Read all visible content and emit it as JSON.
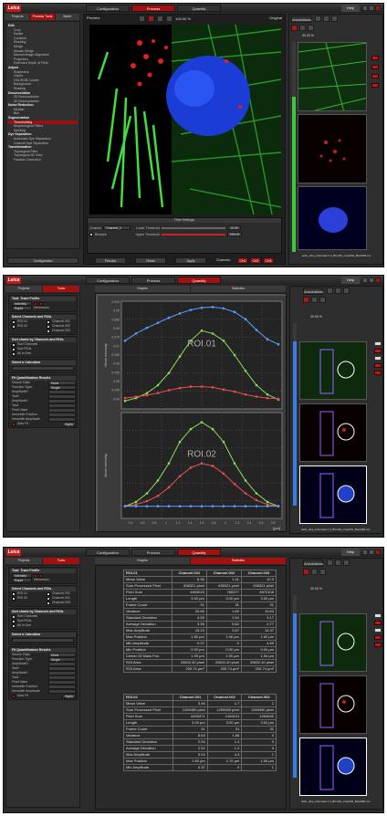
{
  "app": {
    "logo": "Leica",
    "help": "Help"
  },
  "screens": [
    {
      "tabs": [
        "Configuration",
        "Process",
        "Quantify"
      ],
      "active": 1
    },
    {
      "tabs": [
        "Configuration",
        "Process",
        "Quantify"
      ],
      "active": 2
    },
    {
      "tabs": [
        "Configuration",
        "Process",
        "Quantify"
      ],
      "active": 2
    }
  ],
  "s1": {
    "subtabs": [
      "Projects",
      "Process Tools",
      "Batch Deconvolution"
    ],
    "tree": [
      {
        "t": "Edit",
        "h": 1
      },
      {
        "t": "Crop"
      },
      {
        "t": "Rotate"
      },
      {
        "t": "Combine"
      },
      {
        "t": "Resizing"
      },
      {
        "t": "Merge"
      },
      {
        "t": "Mosaic Merge"
      },
      {
        "t": "Manual Image Alignment"
      },
      {
        "t": "Projection"
      },
      {
        "t": "Extended Depth of Field"
      },
      {
        "t": "Adjust",
        "h": 1
      },
      {
        "t": "Sharpness"
      },
      {
        "t": "Colors"
      },
      {
        "t": "HSL/RGB Curves"
      },
      {
        "t": "Background"
      },
      {
        "t": "Shading"
      },
      {
        "t": "Deconvolution",
        "h": 1
      },
      {
        "t": "2D Deconvolution"
      },
      {
        "t": "3D Deconvolution"
      },
      {
        "t": "Noise Reduction",
        "h": 1
      },
      {
        "t": "Median"
      },
      {
        "t": "Blur"
      },
      {
        "t": "Segmentation",
        "h": 1
      },
      {
        "t": "Thresholding",
        "sel": 1
      },
      {
        "t": "Morphological Filters"
      },
      {
        "t": "Seeding"
      },
      {
        "t": "Dye Separation",
        "h": 1
      },
      {
        "t": "Automatic Dye Separation"
      },
      {
        "t": "Channel Dye Separation"
      },
      {
        "t": "Transformation",
        "h": 1
      },
      {
        "t": "Topological Filter"
      },
      {
        "t": "Topological 3D View"
      },
      {
        "t": "Parallax Correction"
      }
    ],
    "config": "Configuration",
    "preview": "Preview",
    "original": "Original",
    "zoom": "100.00 %",
    "filter": {
      "title": "Filter Settings",
      "channel_label": "Channel",
      "channel": "Channel_1",
      "lower_label": "Lower Threshold",
      "lower": "10.00",
      "upper_label": "Upper Threshold",
      "upper": "255.00",
      "binarize": "Binarize"
    },
    "buttons": {
      "preview": "Preview",
      "reset": "Reset",
      "apply": "Apply",
      "channels": "Channels:",
      "ch1": "CH1",
      "ch2": "CH2",
      "ch3": "CH3"
    },
    "annotations": "Annotations",
    "zoom2": "30.00 %",
    "file": "actin_dna_mitomask 2 2_BG.lif/a_Crop001_Bsub001.ics"
  },
  "s2": {
    "subtabs": [
      "Projects",
      "Tools"
    ],
    "charttabs": [
      "Graphs",
      "Statistics"
    ],
    "tool": "Tool: Trace Profile",
    "intensity": "Intensity",
    "rapid": "Rapid",
    "dimension": "Dimension",
    "sel_hdr": "Select Channels and ROIs",
    "rois": [
      "ROI.01",
      "ROI.02"
    ],
    "channels": [
      "Channel.001",
      "Channel.002",
      "Channel.003"
    ],
    "sort_hdr": "Sort charts by Channels and ROIs",
    "sorts": [
      "Sort Channels",
      "Sort ROIs",
      "All in One"
    ],
    "calc_hdr": "Select a Calculator",
    "fit_hdr": "Fit Quantification Results",
    "fit_rows": [
      "Source Data:",
      "Function Type:",
      "Amplitude0",
      "Tau0",
      "Amplitude1",
      "Tau1",
      "Final Value",
      "Immobile Fraction",
      "Immobile Amplitude"
    ],
    "fit_vals": [
      "None",
      "Single Exponential",
      "",
      "",
      "",
      "",
      "",
      "",
      ""
    ],
    "autofit": "Auto Fit",
    "apply": "Apply",
    "xunit": "[µm]",
    "ylabel": "Mean intensity",
    "file": "actin_dna_mitomask 2 2_BG.lif/a_Crop001_Bsub001.ics",
    "size": "Size: 0.00 µm x 0.00 µm"
  },
  "s3": {
    "roi1": {
      "header": [
        "ROI.01",
        "Channel.001",
        "Channel.002",
        "Channel.003"
      ],
      "rows": [
        [
          "Mean Value",
          "6.36",
          "1.11",
          "10.3"
        ],
        [
          "Sum Processed Pixel",
          "638321 pixel",
          "638321 pixel",
          "638321 pixel"
        ],
        [
          "Pixel Sum",
          "4803015",
          "785377",
          "6572108"
        ],
        [
          "Length",
          "3.00 µm",
          "3.00 µm",
          "3.00 µm"
        ],
        [
          "Frame Count",
          "31",
          "31",
          "31"
        ],
        [
          "Variance",
          "20.66",
          "1.69",
          "10.63"
        ],
        [
          "Standard Deviation",
          "4.55",
          "1.54",
          "3.17"
        ],
        [
          "Average Deviation",
          "3.96",
          "0.62",
          "2.77"
        ],
        [
          "Max Amplitude",
          "13.23",
          "2.67",
          "14.37"
        ],
        [
          "Max Position",
          "1.80 µm",
          "1.96 µm",
          "1.60 µm"
        ],
        [
          "Min Amplitude",
          "0.37",
          "0",
          "4.69"
        ],
        [
          "Min Position",
          "0.00 µm",
          "0.00 µm",
          "0.00 µm"
        ],
        [
          "Center Of Mass Pos.",
          "1.59 µm",
          "1.90 µm",
          "1.54 µm"
        ],
        [
          "ROI Area",
          "20602.40 pixel",
          "20602.40 pixel",
          "20602.40 pixel"
        ],
        [
          "ROI Area",
          "205.74 µm²",
          "205.74 µm²",
          "205.74 µm²"
        ]
      ]
    },
    "roi2": {
      "header": [
        "ROI.02",
        "Channel.001",
        "Channel.002",
        "Channel.003"
      ],
      "rows": [
        [
          "Mean Value",
          "3.46",
          "1.7",
          "1"
        ],
        [
          "Sum Processed Pixel",
          "1269450 pixel",
          "1269450 pixel",
          "1269450 pixel"
        ],
        [
          "Pixel Sum",
          "4403471",
          "2164101",
          "1264630"
        ],
        [
          "Length",
          "3.00 µm",
          "3.00 µm",
          "3.00 µm"
        ],
        [
          "Frame Count",
          "31",
          "31",
          "31"
        ],
        [
          "Variance",
          "8.63",
          "1.86",
          "0"
        ],
        [
          "Standard Deviation",
          "2.94",
          "1.4",
          "0"
        ],
        [
          "Average Deviation",
          "2.51",
          "1.2",
          "0"
        ],
        [
          "Max Amplitude",
          "9.04",
          "4.3",
          "1"
        ],
        [
          "Max Position",
          "1.60 µm",
          "1.70 µm",
          "1.90 µm"
        ],
        [
          "Min Amplitude",
          "0.37",
          "0",
          "1"
        ]
      ]
    },
    "file": "actin_dna_mitomask 2 2_BG.lif/a_Crop001_Bsub001.ics",
    "size": "Size: 0.00 µm x 0.00 µm"
  },
  "chart_data": {
    "type": "line",
    "panels": [
      {
        "title": "ROI.01",
        "series": [
          {
            "color": "#5aa0ff",
            "values": [
              0.09,
              0.1,
              0.108,
              0.115,
              0.122,
              0.128,
              0.133,
              0.136,
              0.137,
              0.135,
              0.13,
              0.12,
              0.105,
              0.092,
              0.085
            ]
          },
          {
            "color": "#8cdc5a",
            "values": [
              0.006,
              0.01,
              0.017,
              0.028,
              0.045,
              0.068,
              0.09,
              0.104,
              0.1,
              0.09,
              0.07,
              0.048,
              0.028,
              0.015,
              0.008
            ]
          },
          {
            "color": "#e85050",
            "values": [
              0.01,
              0.012,
              0.014,
              0.017,
              0.021,
              0.024,
              0.026,
              0.026,
              0.025,
              0.022,
              0.019,
              0.015,
              0.012,
              0.01,
              0.009
            ]
          }
        ]
      },
      {
        "title": "ROI.02",
        "series": [
          {
            "color": "#8cdc5a",
            "values": [
              0.01,
              0.015,
              0.025,
              0.04,
              0.06,
              0.085,
              0.1,
              0.108,
              0.1,
              0.085,
              0.06,
              0.04,
              0.025,
              0.015,
              0.01
            ]
          },
          {
            "color": "#e85050",
            "values": [
              0.01,
              0.012,
              0.016,
              0.022,
              0.032,
              0.045,
              0.055,
              0.06,
              0.057,
              0.048,
              0.036,
              0.025,
              0.017,
              0.012,
              0.01
            ]
          },
          {
            "color": "#5aa0ff",
            "values": [
              0.01,
              0.01,
              0.01,
              0.01,
              0.01,
              0.01,
              0.01,
              0.01,
              0.01,
              0.01,
              0.01,
              0.01,
              0.01,
              0.01,
              0.01
            ]
          }
        ]
      }
    ],
    "xticks": [
      "0.4",
      "0.6",
      "0.8",
      "1",
      "1.2",
      "1.4",
      "1.6",
      "1.8",
      "2",
      "2.2",
      "2.4",
      "2.6",
      "2.8"
    ],
    "yticks_top": [
      "0.093",
      "0.09",
      "0.085",
      "0.08",
      "0.075",
      "0.07",
      "0.065",
      "0.06",
      "0.055",
      "0.05",
      "0.045",
      "0.04"
    ]
  }
}
